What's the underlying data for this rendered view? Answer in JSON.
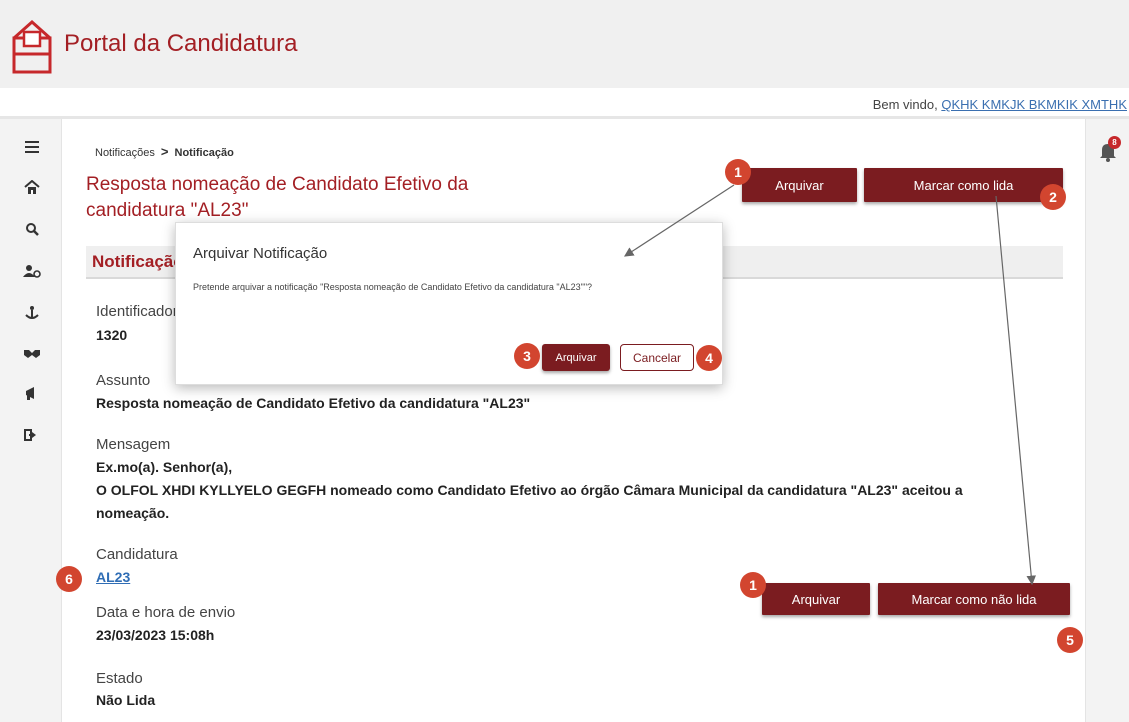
{
  "header": {
    "app_title": "Portal da Candidatura",
    "welcome_prefix": "Bem vindo, ",
    "user_name": "QKHK KMKJK BKMKIK XMTHK"
  },
  "sidebar": {
    "items": [
      {
        "icon": "menu-icon"
      },
      {
        "icon": "home-icon"
      },
      {
        "icon": "search-icon"
      },
      {
        "icon": "users-settings-icon"
      },
      {
        "icon": "person-anchor-icon"
      },
      {
        "icon": "handshake-icon"
      },
      {
        "icon": "megaphone-icon"
      },
      {
        "icon": "sign-out-icon"
      }
    ]
  },
  "notifications": {
    "badge_count": "8",
    "icon": "bell-icon"
  },
  "breadcrumb": {
    "parent": "Notificações",
    "separator": ">",
    "current": "Notificação"
  },
  "page": {
    "title": "Resposta nomeação de Candidato Efetivo da candidatura \"AL23\"",
    "archive_label": "Arquivar",
    "mark_read_label": "Marcar como lida",
    "mark_unread_label": "Marcar como não lida",
    "section_title": "Notificação"
  },
  "fields": {
    "id_label": "Identificador",
    "id_value": "1320",
    "subject_label": "Assunto",
    "subject_value": "Resposta nomeação de Candidato Efetivo da candidatura \"AL23\"",
    "message_label": "Mensagem",
    "message_line1": "Ex.mo(a). Senhor(a),",
    "message_line2": "O OLFOL XHDI KYLLYELO GEGFH nomeado como Candidato Efetivo ao órgão Câmara Municipal da candidatura \"AL23\" aceitou a",
    "message_line3": "nomeação.",
    "candidatura_label": "Candidatura",
    "candidatura_value": "AL23",
    "sent_label": "Data e hora de envio",
    "sent_value": "23/03/2023 15:08h",
    "state_label": "Estado",
    "state_value": "Não Lida"
  },
  "dialog": {
    "title": "Arquivar Notificação",
    "body": "Pretende arquivar a notificação \"Resposta nomeação de Candidato Efetivo da candidatura \"AL23\"\"?",
    "confirm_label": "Arquivar",
    "cancel_label": "Cancelar"
  },
  "annotations": [
    "1",
    "2",
    "3",
    "4",
    "5",
    "6",
    "1"
  ],
  "colors": {
    "brand": "#a31f24",
    "button": "#7b1c20",
    "marker": "#d2452f",
    "link": "#2f6db5"
  }
}
